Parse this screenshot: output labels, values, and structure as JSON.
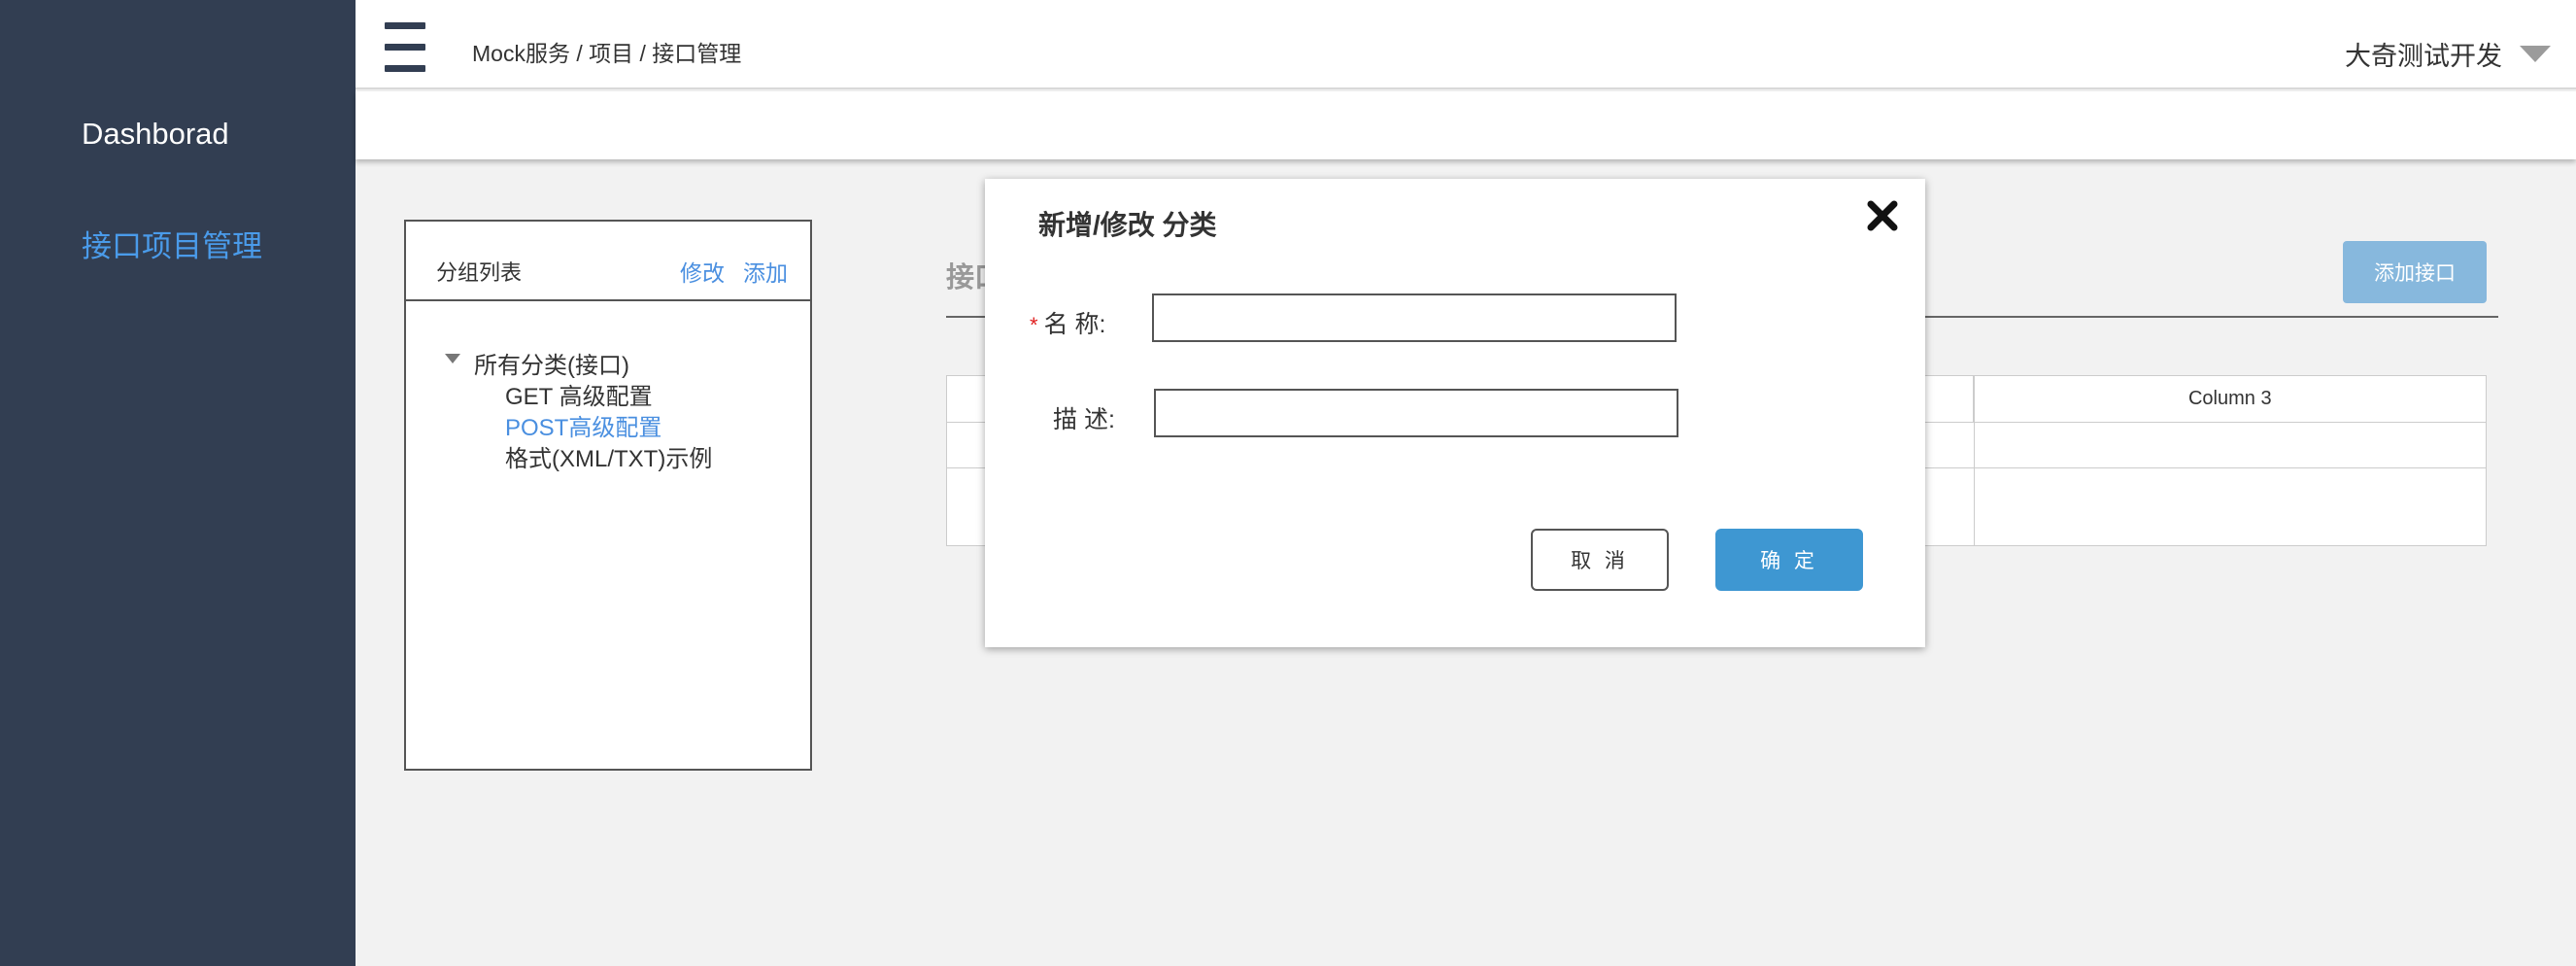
{
  "sidebar": {
    "items": [
      {
        "label": "Dashborad"
      },
      {
        "label": "接口项目管理"
      }
    ]
  },
  "header": {
    "breadcrumb": "Mock服务 / 项目 / 接口管理",
    "user": "大奇测试开发"
  },
  "group_panel": {
    "title": "分组列表",
    "edit_label": "修改",
    "add_label": "添加",
    "tree": {
      "root": "所有分类(接口)",
      "children": [
        {
          "label": "GET 高级配置"
        },
        {
          "label": "POST高级配置"
        },
        {
          "label": "格式(XML/TXT)示例"
        }
      ]
    }
  },
  "main": {
    "title": "接口",
    "add_api_label": "添加接口",
    "table": {
      "columns": [
        "",
        "",
        "Column 3"
      ]
    }
  },
  "modal": {
    "title": "新增/修改 分类",
    "name_required_mark": "*",
    "name_label": "名 称:",
    "name_value": "",
    "desc_label": "描 述:",
    "desc_value": "",
    "cancel_label": "取 消",
    "confirm_label": "确 定"
  },
  "colors": {
    "sidebar_bg": "#323e52",
    "accent": "#4a8fe0",
    "primary_button": "#3e97d2",
    "disabled_button": "#87b8dd",
    "required": "#e02020"
  }
}
